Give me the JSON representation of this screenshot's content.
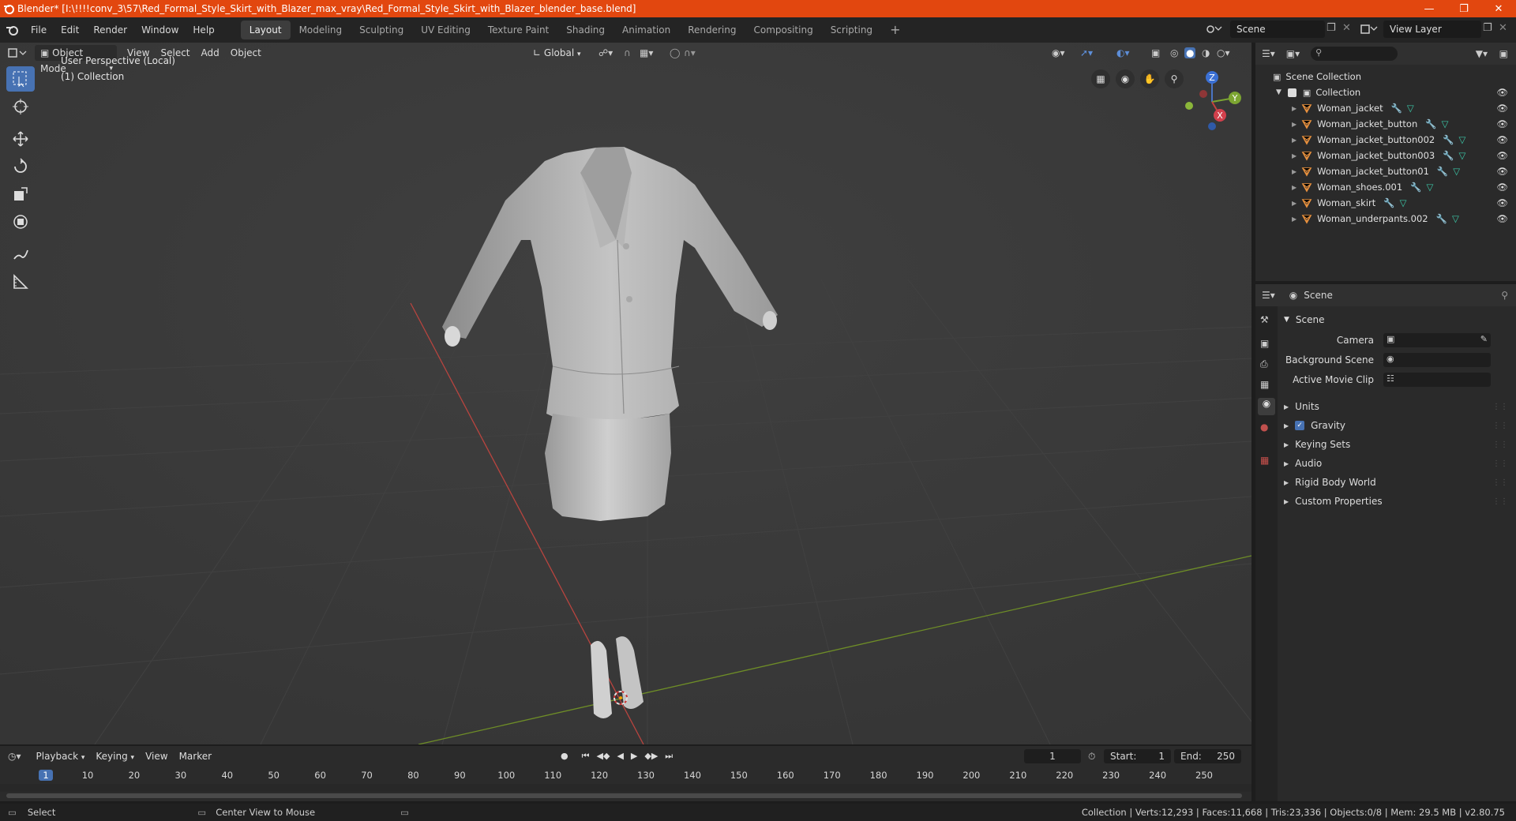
{
  "window": {
    "title": "Blender* [I:\\!!!!conv_3\\57\\Red_Formal_Style_Skirt_with_Blazer_max_vray\\Red_Formal_Style_Skirt_with_Blazer_blender_base.blend]",
    "accent": "#e2470f"
  },
  "menu": [
    "File",
    "Edit",
    "Render",
    "Window",
    "Help"
  ],
  "workspaces": [
    "Layout",
    "Modeling",
    "Sculpting",
    "UV Editing",
    "Texture Paint",
    "Shading",
    "Animation",
    "Rendering",
    "Compositing",
    "Scripting"
  ],
  "active_workspace": "Layout",
  "scene_selector": {
    "label": "Scene"
  },
  "view_layer_selector": {
    "label": "View Layer"
  },
  "viewport": {
    "mode": "Object Mode",
    "menus": [
      "View",
      "Select",
      "Add",
      "Object"
    ],
    "transform_orientation": "Global",
    "info_line1": "User Perspective (Local)",
    "info_line2": "(1) Collection",
    "gizmo_axes": {
      "z": "Z",
      "y": "Y",
      "x": "X"
    }
  },
  "outliner": {
    "root": "Scene Collection",
    "collection": "Collection",
    "objects": [
      "Woman_jacket",
      "Woman_jacket_button",
      "Woman_jacket_button002",
      "Woman_jacket_button003",
      "Woman_jacket_button01",
      "Woman_shoes.001",
      "Woman_skirt",
      "Woman_underpants.002"
    ]
  },
  "properties": {
    "header": "Scene",
    "section": "Scene",
    "fields": [
      {
        "label": "Camera"
      },
      {
        "label": "Background Scene"
      },
      {
        "label": "Active Movie Clip"
      }
    ],
    "subpanels": [
      "Units",
      "Gravity",
      "Keying Sets",
      "Audio",
      "Rigid Body World",
      "Custom Properties"
    ],
    "gravity_checked": true
  },
  "timeline": {
    "menus": [
      "Playback",
      "Keying",
      "View",
      "Marker"
    ],
    "current_frame": "1",
    "start_label": "Start:",
    "start": "1",
    "end_label": "End:",
    "end": "250",
    "ruler": [
      "1",
      "10",
      "20",
      "30",
      "40",
      "50",
      "60",
      "70",
      "80",
      "90",
      "100",
      "110",
      "120",
      "130",
      "140",
      "150",
      "160",
      "170",
      "180",
      "190",
      "200",
      "210",
      "220",
      "230",
      "240",
      "250"
    ]
  },
  "statusbar": {
    "left": "Select",
    "middle": "Center View to Mouse",
    "stats": "Collection | Verts:12,293 | Faces:11,668 | Tris:23,336 | Objects:0/8 | Mem: 29.5 MB | v2.80.75"
  }
}
